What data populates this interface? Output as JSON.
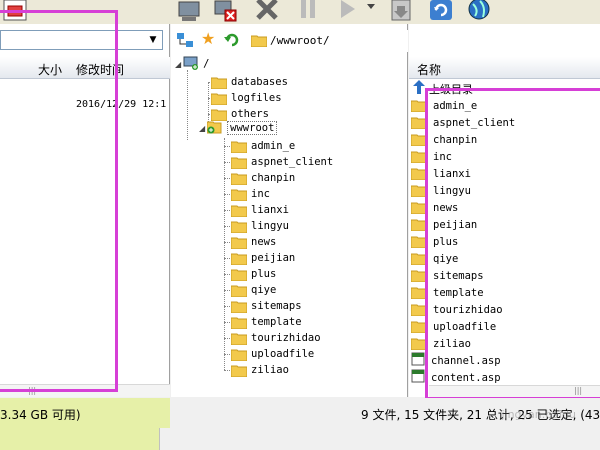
{
  "left_pane": {
    "col_size": "大小",
    "col_modified": "修改时间",
    "row_modified": "2016/12/29 12:1"
  },
  "path_bar": {
    "path": "/wwwroot/"
  },
  "tree": {
    "root": "/",
    "top_folders": [
      "databases",
      "logfiles",
      "others"
    ],
    "wwwroot": "wwwroot",
    "children": [
      "admin_e",
      "aspnet_client",
      "chanpin",
      "inc",
      "lianxi",
      "lingyu",
      "news",
      "peijian",
      "plus",
      "qiye",
      "sitemaps",
      "template",
      "tourizhidao",
      "uploadfile",
      "ziliao"
    ]
  },
  "right_pane": {
    "col_name": "名称",
    "parent_dir": "上级目录",
    "items": [
      {
        "label": "admin_e",
        "type": "folder"
      },
      {
        "label": "aspnet_client",
        "type": "folder"
      },
      {
        "label": "chanpin",
        "type": "folder"
      },
      {
        "label": "inc",
        "type": "folder"
      },
      {
        "label": "lianxi",
        "type": "folder"
      },
      {
        "label": "lingyu",
        "type": "folder"
      },
      {
        "label": "news",
        "type": "folder"
      },
      {
        "label": "peijian",
        "type": "folder"
      },
      {
        "label": "plus",
        "type": "folder"
      },
      {
        "label": "qiye",
        "type": "folder"
      },
      {
        "label": "sitemaps",
        "type": "folder"
      },
      {
        "label": "template",
        "type": "folder"
      },
      {
        "label": "tourizhidao",
        "type": "folder"
      },
      {
        "label": "uploadfile",
        "type": "folder"
      },
      {
        "label": "ziliao",
        "type": "folder"
      },
      {
        "label": "channel.asp",
        "type": "file"
      },
      {
        "label": "content.asp",
        "type": "file"
      }
    ]
  },
  "status": {
    "left": "3.34 GB 可用)",
    "right": "9 文件, 15 文件夹, 21 总计, 25 已选定, (43"
  },
  "watermark": "jingyan.baidu",
  "colors": {
    "highlight": "#d63fd6",
    "status_left_bg": "#e6f0a8",
    "folder": "#f2c94c"
  }
}
